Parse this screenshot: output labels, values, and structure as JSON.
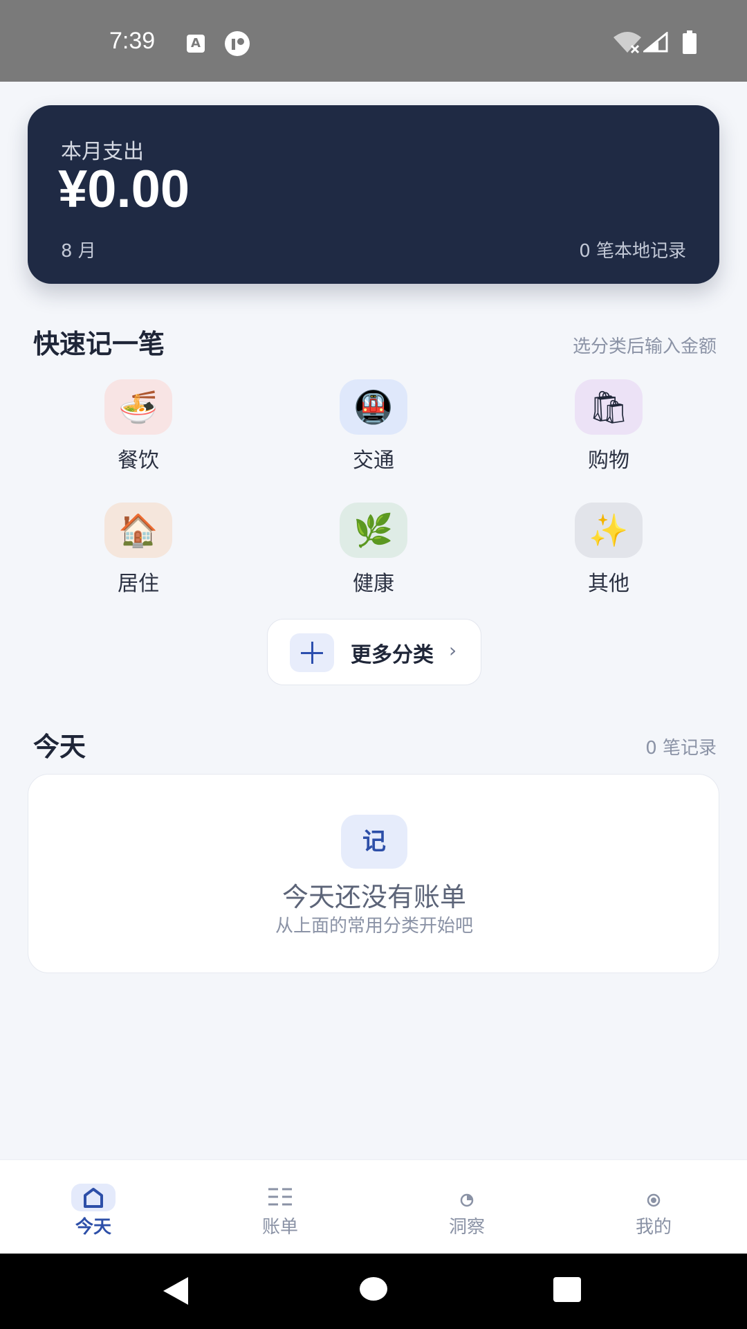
{
  "status_bar": {
    "time": "7:39",
    "icons": [
      "a-notification-icon",
      "circle-app-icon",
      "wifi-off-icon",
      "signal-icon",
      "battery-icon"
    ]
  },
  "summary": {
    "label": "本月支出",
    "amount": "¥0.00",
    "month": "8 月",
    "records": "0 笔本地记录",
    "background": "#1f2a44"
  },
  "quick_entry": {
    "title": "快速记一笔",
    "hint": "选分类后输入金额",
    "categories": [
      {
        "label": "餐饮",
        "icon": "🍜",
        "icon_name": "noodle-bowl-icon",
        "bg": "#f8e4e4"
      },
      {
        "label": "交通",
        "icon": "🚇",
        "icon_name": "metro-icon",
        "bg": "#dfe8fb"
      },
      {
        "label": "购物",
        "icon": "🛍",
        "icon_name": "shopping-bags-icon",
        "bg": "#ece2f6"
      },
      {
        "label": "居住",
        "icon": "🏠",
        "icon_name": "house-icon",
        "bg": "#f5e6dc"
      },
      {
        "label": "健康",
        "icon": "🌿",
        "icon_name": "herb-icon",
        "bg": "#dfece6"
      },
      {
        "label": "其他",
        "icon": "✨",
        "icon_name": "sparkles-icon",
        "bg": "#e2e4ea"
      }
    ],
    "more_label": "更多分类",
    "more_chevron": "›"
  },
  "today": {
    "title": "今天",
    "count": "0 笔记录",
    "empty_badge": "记",
    "empty_title": "今天还没有账单",
    "empty_subtitle": "从上面的常用分类开始吧"
  },
  "bottom_nav": {
    "items": [
      {
        "label": "今天",
        "icon": "⌂",
        "active": true
      },
      {
        "label": "账单",
        "icon": "☷",
        "active": false
      },
      {
        "label": "洞察",
        "icon": "◔",
        "active": false
      },
      {
        "label": "我的",
        "icon": "◉",
        "active": false
      }
    ],
    "accent": "#2d4fa8"
  }
}
